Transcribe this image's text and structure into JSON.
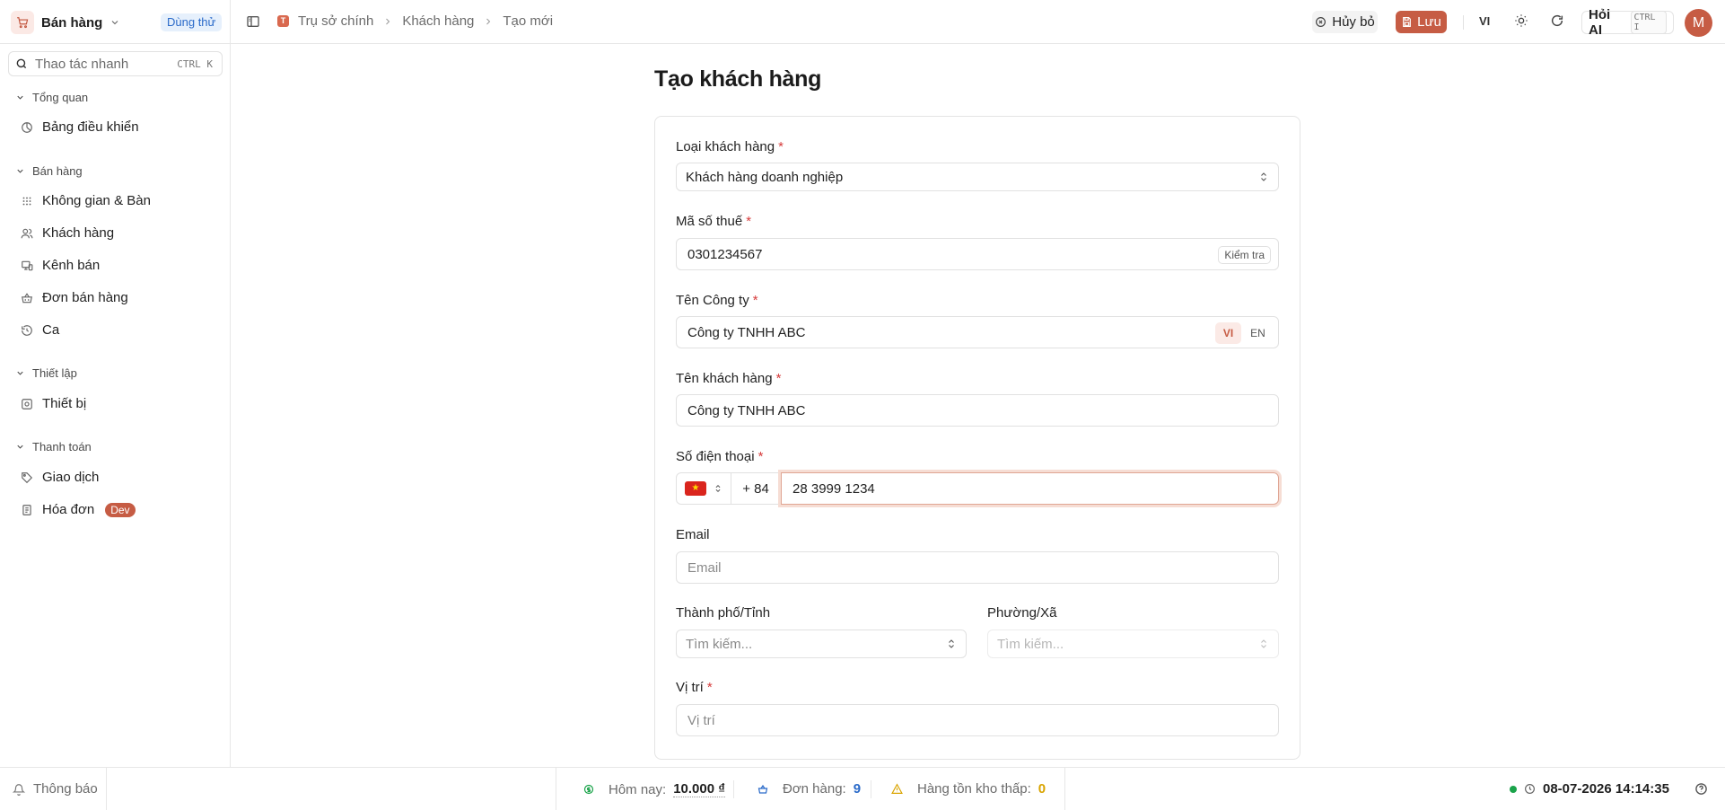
{
  "header": {
    "app_name": "Bán hàng",
    "trial_badge": "Dùng thử",
    "breadcrumb_badge": "T",
    "breadcrumb": [
      "Trụ sở chính",
      "Khách hàng",
      "Tạo mới"
    ],
    "cancel_label": "Hủy bỏ",
    "save_label": "Lưu",
    "language": "VI",
    "ask_ai_label": "Hỏi AI",
    "ask_ai_shortcut": "CTRL I",
    "avatar_initial": "M",
    "accent_color": "#c65c44"
  },
  "sidebar": {
    "search_placeholder": "Thao tác nhanh",
    "search_shortcut": "CTRL K",
    "groups": [
      {
        "title": "Tổng quan",
        "items": [
          {
            "label": "Bảng điều khiển",
            "icon": "dashboard-icon"
          }
        ]
      },
      {
        "title": "Bán hàng",
        "items": [
          {
            "label": "Không gian & Bàn",
            "icon": "grid-icon"
          },
          {
            "label": "Khách hàng",
            "icon": "users-icon"
          },
          {
            "label": "Kênh bán",
            "icon": "channel-icon"
          },
          {
            "label": "Đơn bán hàng",
            "icon": "basket-icon"
          },
          {
            "label": "Ca",
            "icon": "history-icon"
          }
        ]
      },
      {
        "title": "Thiết lập",
        "items": [
          {
            "label": "Thiết bị",
            "icon": "device-icon"
          }
        ]
      },
      {
        "title": "Thanh toán",
        "items": [
          {
            "label": "Giao dịch",
            "icon": "tag-icon"
          },
          {
            "label": "Hóa đơn",
            "icon": "invoice-icon",
            "badge": "Dev"
          }
        ]
      }
    ]
  },
  "form": {
    "title": "Tạo khách hàng",
    "customer_type": {
      "label": "Loại khách hàng",
      "value": "Khách hàng doanh nghiệp"
    },
    "tax_code": {
      "label": "Mã số thuế",
      "value": "0301234567",
      "check_label": "Kiểm tra"
    },
    "company_name": {
      "label": "Tên Công ty",
      "value": "Công ty TNHH ABC",
      "lang_vi": "VI",
      "lang_en": "EN"
    },
    "customer_name": {
      "label": "Tên khách hàng",
      "value": "Công ty TNHH ABC"
    },
    "phone": {
      "label": "Số điện thoại",
      "country_code": "+ 84",
      "value": "28 3999 1234"
    },
    "email": {
      "label": "Email",
      "placeholder": "Email"
    },
    "city": {
      "label": "Thành phố/Tỉnh",
      "placeholder": "Tìm kiếm..."
    },
    "ward": {
      "label": "Phường/Xã",
      "placeholder": "Tìm kiếm..."
    },
    "location": {
      "label": "Vị trí",
      "placeholder": "Vị trí"
    },
    "required_mark": "*"
  },
  "footer": {
    "notifications_label": "Thông báo",
    "today_label": "Hôm nay:",
    "today_value": "10.000 ₫",
    "orders_label": "Đơn hàng:",
    "orders_value": "9",
    "low_stock_label": "Hàng tồn kho thấp:",
    "low_stock_value": "0",
    "datetime": "08-07-2026 14:14:35"
  }
}
